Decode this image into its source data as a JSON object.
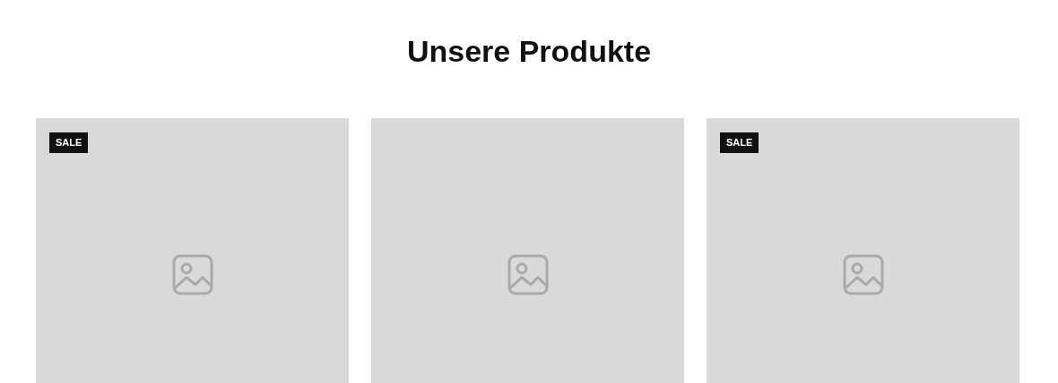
{
  "title": "Unsere Produkte",
  "products": [
    {
      "on_sale": true,
      "badge": "SALE"
    },
    {
      "on_sale": false
    },
    {
      "on_sale": true,
      "badge": "SALE"
    }
  ]
}
